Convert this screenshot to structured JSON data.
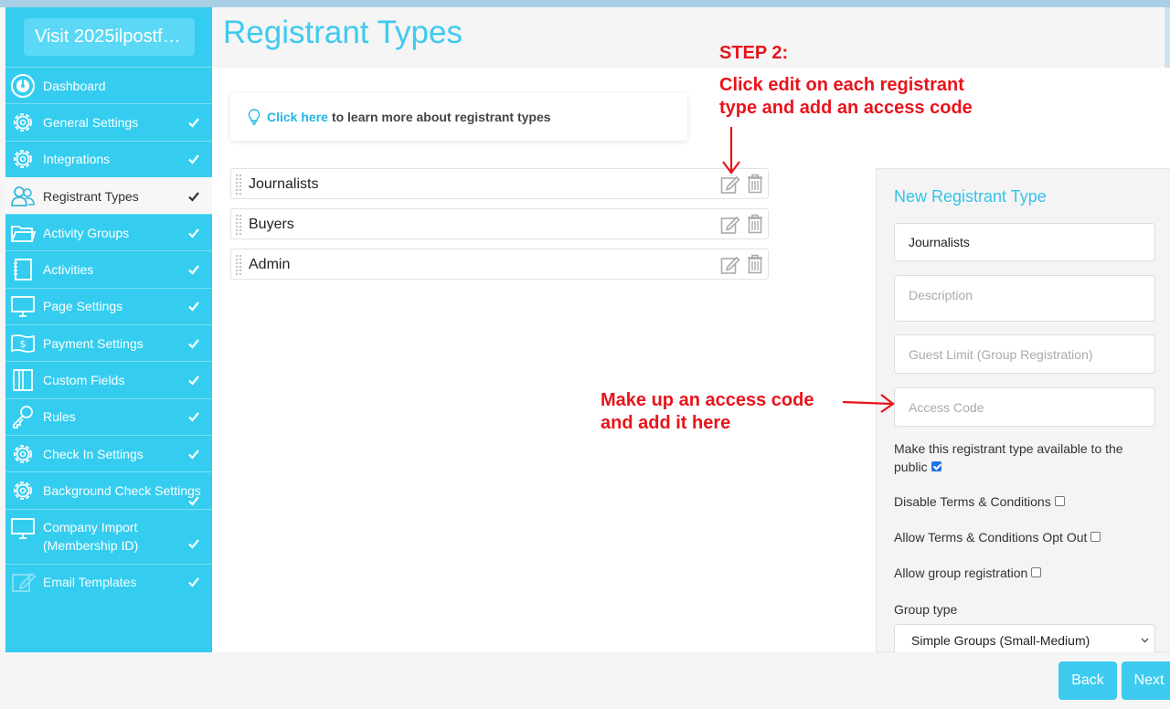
{
  "app": {
    "visit_button": "Visit 2025ilpostf…",
    "page_title": "Registrant Types"
  },
  "sidebar": {
    "items": [
      {
        "label": "Dashboard",
        "icon": "dashboard-icon",
        "checked": false
      },
      {
        "label": "General Settings",
        "icon": "gear-icon",
        "checked": true
      },
      {
        "label": "Integrations",
        "icon": "gear-icon",
        "checked": true
      },
      {
        "label": "Registrant Types",
        "icon": "users-icon",
        "checked": true,
        "active": true
      },
      {
        "label": "Activity Groups",
        "icon": "folder-icon",
        "checked": true
      },
      {
        "label": "Activities",
        "icon": "notebook-icon",
        "checked": true
      },
      {
        "label": "Page Settings",
        "icon": "monitor-icon",
        "checked": true
      },
      {
        "label": "Payment Settings",
        "icon": "dollar-bill-icon",
        "checked": true
      },
      {
        "label": "Custom Fields",
        "icon": "book-icon",
        "checked": true
      },
      {
        "label": "Rules",
        "icon": "key-icon",
        "checked": true
      },
      {
        "label": "Check In Settings",
        "icon": "gear-icon",
        "checked": true
      },
      {
        "label": "Background Check Settings",
        "icon": "gear-icon",
        "checked": true
      },
      {
        "label_line1": "Company Import",
        "label_line2": "(Membership ID)",
        "icon": "monitor-icon",
        "checked": true
      },
      {
        "label": "Email Templates",
        "icon": "pencil-square-icon",
        "checked": true
      }
    ]
  },
  "tip": {
    "link_text": "Click here",
    "rest_text": "to learn more about registrant types"
  },
  "registrant_types": [
    {
      "name": "Journalists"
    },
    {
      "name": "Buyers"
    },
    {
      "name": "Admin"
    }
  ],
  "panel": {
    "title": "New Registrant Type",
    "name_value": "Journalists",
    "description_placeholder": "Description",
    "guest_limit_placeholder": "Guest Limit (Group Registration)",
    "access_code_placeholder": "Access Code",
    "public_label": "Make this registrant type available to the public",
    "public_checked": true,
    "disable_terms_label": "Disable Terms & Conditions",
    "disable_terms_checked": false,
    "allow_opt_out_label": "Allow Terms & Conditions Opt Out",
    "allow_opt_out_checked": false,
    "allow_group_label": "Allow group registration",
    "allow_group_checked": false,
    "group_type_label": "Group type",
    "group_type_value": "Simple Groups (Small-Medium)"
  },
  "footer": {
    "back_label": "Back",
    "next_label": "Next"
  },
  "annotations": {
    "step_title": "STEP 2:",
    "step_line1": "Click edit on each registrant",
    "step_line2": "type and add an access code",
    "access_line1": "Make up an access code",
    "access_line2": "and add it here",
    "color": "#e8141b"
  },
  "colors": {
    "accent": "#3ccbef",
    "sidebar": "#34cdf0"
  }
}
